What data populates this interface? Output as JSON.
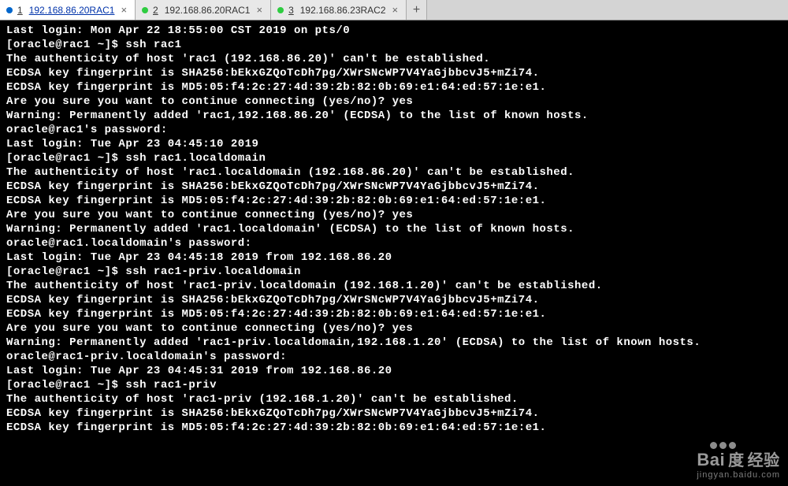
{
  "tabs": [
    {
      "num": "1",
      "label": "192.168.86.20RAC1",
      "active": true,
      "dotClass": "blue"
    },
    {
      "num": "2",
      "label": "192.168.86.20RAC1",
      "active": false,
      "dotClass": ""
    },
    {
      "num": "3",
      "label": "192.168.86.23RAC2",
      "active": false,
      "dotClass": ""
    }
  ],
  "addSymbol": "+",
  "closeSymbol": "×",
  "lines": [
    "Last login: Mon Apr 22 18:55:00 CST 2019 on pts/0",
    "[oracle@rac1 ~]$ ssh rac1",
    "The authenticity of host 'rac1 (192.168.86.20)' can't be established.",
    "ECDSA key fingerprint is SHA256:bEkxGZQoTcDh7pg/XWrSNcWP7V4YaGjbbcvJ5+mZi74.",
    "ECDSA key fingerprint is MD5:05:f4:2c:27:4d:39:2b:82:0b:69:e1:64:ed:57:1e:e1.",
    "Are you sure you want to continue connecting (yes/no)? yes",
    "Warning: Permanently added 'rac1,192.168.86.20' (ECDSA) to the list of known hosts.",
    "oracle@rac1's password:",
    "Last login: Tue Apr 23 04:45:10 2019",
    "[oracle@rac1 ~]$ ssh rac1.localdomain",
    "The authenticity of host 'rac1.localdomain (192.168.86.20)' can't be established.",
    "ECDSA key fingerprint is SHA256:bEkxGZQoTcDh7pg/XWrSNcWP7V4YaGjbbcvJ5+mZi74.",
    "ECDSA key fingerprint is MD5:05:f4:2c:27:4d:39:2b:82:0b:69:e1:64:ed:57:1e:e1.",
    "Are you sure you want to continue connecting (yes/no)? yes",
    "Warning: Permanently added 'rac1.localdomain' (ECDSA) to the list of known hosts.",
    "oracle@rac1.localdomain's password:",
    "Last login: Tue Apr 23 04:45:18 2019 from 192.168.86.20",
    "[oracle@rac1 ~]$ ssh rac1-priv.localdomain",
    "The authenticity of host 'rac1-priv.localdomain (192.168.1.20)' can't be established.",
    "ECDSA key fingerprint is SHA256:bEkxGZQoTcDh7pg/XWrSNcWP7V4YaGjbbcvJ5+mZi74.",
    "ECDSA key fingerprint is MD5:05:f4:2c:27:4d:39:2b:82:0b:69:e1:64:ed:57:1e:e1.",
    "Are you sure you want to continue connecting (yes/no)? yes",
    "Warning: Permanently added 'rac1-priv.localdomain,192.168.1.20' (ECDSA) to the list of known hosts.",
    "oracle@rac1-priv.localdomain's password:",
    "Last login: Tue Apr 23 04:45:31 2019 from 192.168.86.20",
    "[oracle@rac1 ~]$ ssh rac1-priv",
    "The authenticity of host 'rac1-priv (192.168.1.20)' can't be established.",
    "ECDSA key fingerprint is SHA256:bEkxGZQoTcDh7pg/XWrSNcWP7V4YaGjbbcvJ5+mZi74.",
    "ECDSA key fingerprint is MD5:05:f4:2c:27:4d:39:2b:82:0b:69:e1:64:ed:57:1e:e1."
  ],
  "watermark": {
    "brand": "Bai",
    "brandIcon": "度",
    "cn": "经验",
    "sub": "jingyan.baidu.com"
  }
}
